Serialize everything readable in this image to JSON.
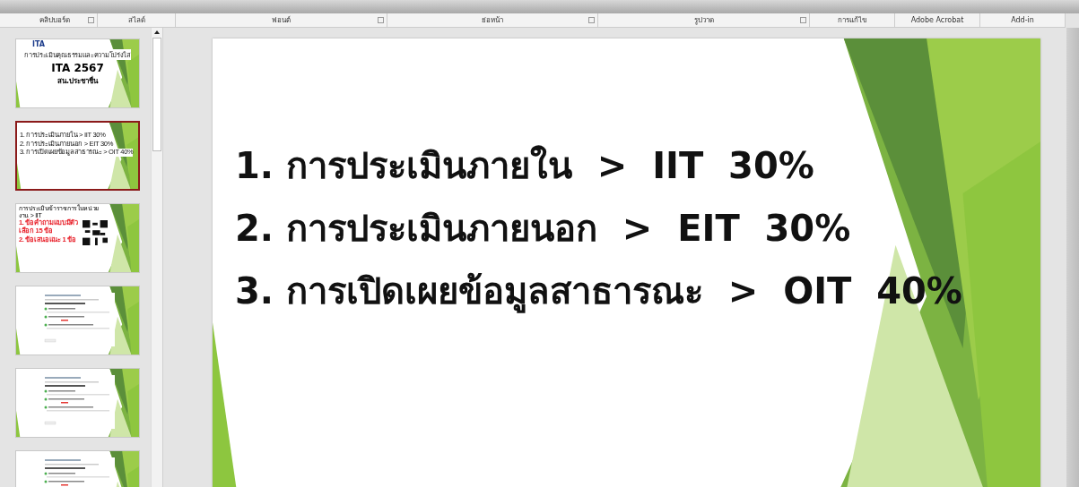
{
  "ribbon_groups": [
    {
      "label": "คลิปบอร์ด",
      "launcher": true
    },
    {
      "label": "สไลด์",
      "launcher": false
    },
    {
      "label": "ฟอนต์",
      "launcher": true
    },
    {
      "label": "ย่อหน้า",
      "launcher": true
    },
    {
      "label": "รูปวาด",
      "launcher": true
    },
    {
      "label": "การแก้ไข",
      "launcher": false
    },
    {
      "label": "Adobe Acrobat",
      "launcher": false
    },
    {
      "label": "Add-in",
      "launcher": false
    }
  ],
  "thumbnails": [
    {
      "kind": "title",
      "selected": false,
      "logo": "ITA",
      "heading": "การประเมินคุณธรรมและความโปร่งใส",
      "title": "ITA 2567",
      "subtitle": "สน.ประชาชื่น"
    },
    {
      "kind": "list",
      "selected": true,
      "lines": [
        "1. การประเมินภายใน  >  IIT  30%",
        "2. การประเมินภายนอก  >  EIT  30%",
        "3. การเปิดเผยข้อมูลสาธารณะ  >  OIT  40%"
      ]
    },
    {
      "kind": "qr",
      "selected": false,
      "heading": "การประเมินข้าราชการในหน่วยงาน  >  IIT",
      "lines": [
        "1. ข้อคำถามแบบมีตัวเลือก  15  ข้อ",
        "2. ข้อเสนอแนะ  1  ข้อ"
      ]
    },
    {
      "kind": "form",
      "selected": false
    },
    {
      "kind": "form",
      "selected": false
    },
    {
      "kind": "form",
      "selected": false
    }
  ],
  "slide": {
    "lines": [
      "1. การประเมินภายใน  >  IIT  30%",
      "2. การประเมินภายนอก  >  EIT  30%",
      "3. การเปิดเผยข้อมูลสาธารณะ  >  OIT  40%"
    ]
  }
}
